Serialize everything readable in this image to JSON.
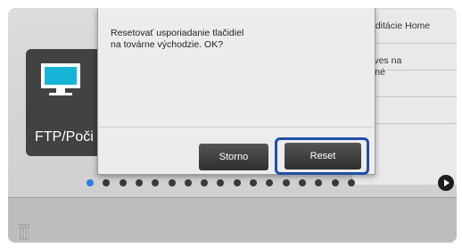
{
  "home": {
    "menu_items": [
      {
        "label": "ec editácie Home"
      },
      {
        "label": "' kláves na\nvolené"
      }
    ],
    "tile": {
      "label": "FTP/Poči"
    },
    "pagination": {
      "dot_count": 17,
      "active_index": 0
    }
  },
  "dialog": {
    "message_line1": "Resetovať usporiadanie tlačidiel",
    "message_line2": "na továrne východzie. OK?",
    "cancel_label": "Storno",
    "reset_label": "Reset"
  },
  "colors": {
    "highlight": "#1f4fa8",
    "active_dot": "#2d7de0"
  }
}
